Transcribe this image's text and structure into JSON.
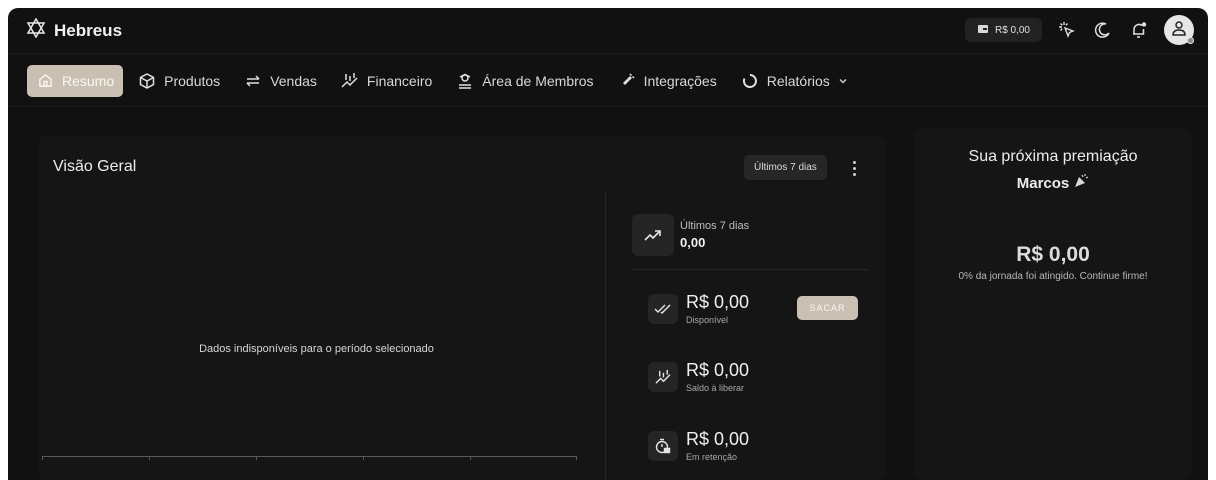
{
  "app": {
    "brand_name": "Hebreus"
  },
  "topbar": {
    "balance": "R$ 0,00",
    "icons": [
      "wallet-icon",
      "sparkle-cursor-icon",
      "moon-icon",
      "bell-icon",
      "user-icon"
    ]
  },
  "nav": {
    "items": [
      {
        "label": "Resumo",
        "icon": "home-icon",
        "active": true
      },
      {
        "label": "Produtos",
        "icon": "box-icon"
      },
      {
        "label": "Vendas",
        "icon": "arrows-swap-icon"
      },
      {
        "label": "Financeiro",
        "icon": "chart-icon"
      },
      {
        "label": "Área de Membros",
        "icon": "members-icon"
      },
      {
        "label": "Integrações",
        "icon": "plug-icon"
      },
      {
        "label": "Relatórios",
        "icon": "circle-icon",
        "dropdown": true
      }
    ]
  },
  "overview": {
    "title": "Visão Geral",
    "period": "Últimos 7 dias",
    "empty_message": "Dados indisponíveis para o período selecionado",
    "trend": {
      "label": "Últimos 7 dias",
      "value": "0,00"
    },
    "available": {
      "amount": "R$ 0,00",
      "label": "Disponível",
      "action": "SACAR"
    },
    "to_release": {
      "amount": "R$ 0,00",
      "label": "Saldo à liberar"
    },
    "retention": {
      "amount": "R$ 0,00",
      "label": "Em retenção"
    }
  },
  "award": {
    "title": "Sua próxima premiação",
    "name": "Marcos",
    "amount": "R$ 0,00",
    "progress_percent": 0,
    "note": "0% da jornada foi atingido. Continue firme!"
  },
  "colors": {
    "background": "#111111",
    "card": "#151515",
    "accent": "#c9c0b3"
  }
}
